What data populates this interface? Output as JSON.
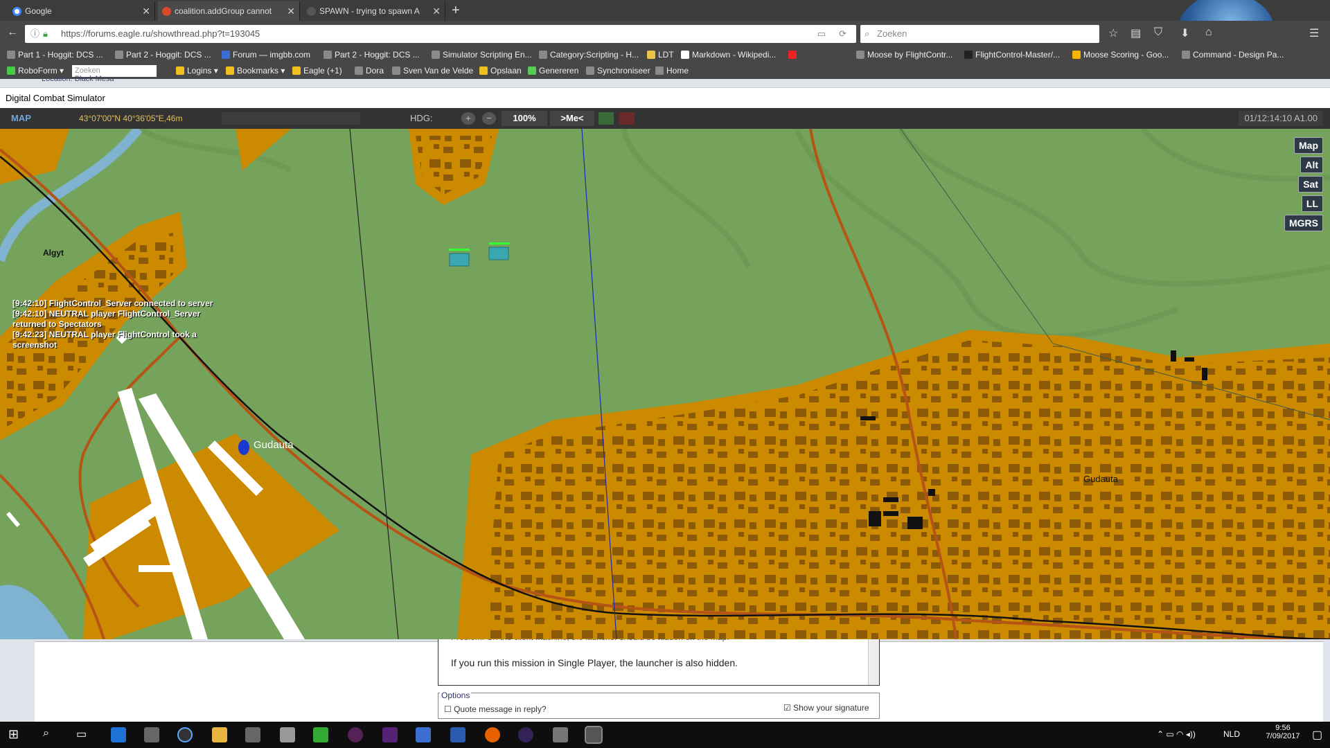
{
  "browser": {
    "tabs": [
      {
        "label": "Google",
        "active": false
      },
      {
        "label": "coalition.addGroup cannot",
        "active": true
      },
      {
        "label": "SPAWN - trying to spawn A",
        "active": false
      }
    ],
    "url": "https://forums.eagle.ru/showthread.php?t=193045",
    "search_placeholder": "Zoeken",
    "bookmarks_row1": [
      "Part 1 - Hoggit: DCS ...",
      "Part 2 - Hoggit: DCS ...",
      "Forum — imgbb.com",
      "Part 2 - Hoggit: DCS ...",
      "Simulator Scripting En...",
      "Category:Scripting - H...",
      "LDT",
      "Markdown - Wikipedi...",
      "Moose by FlightContr...",
      "FlightControl-Master/...",
      "Moose Scoring - Goo...",
      "Command - Design Pa..."
    ],
    "bookmarks_row2": [
      "RoboForm",
      "Logins",
      "Bookmarks",
      "Eagle (+1)",
      "Dora",
      "Sven Van de Velde",
      "Opslaan",
      "Genereren",
      "Synchroniseer",
      "Home"
    ],
    "roboform_search_placeholder": "Zoeken"
  },
  "forum": {
    "location_text": "Location: Black Mesa",
    "editor_line1": "Problem: On the client machine, the launcher should be hidden on the map.",
    "editor_line2": "If you run this mission in Single Player, the launcher is also hidden.",
    "options_label": "Options",
    "quote_label": "Quote message in reply?",
    "signature_label": "Show your signature"
  },
  "dcs": {
    "window_title": "Digital Combat Simulator",
    "map_label": "MAP",
    "coords": "43°07'00\"N 40°36'05\"E,46m",
    "hdg_label": "HDG:",
    "zoom": "100%",
    "me_button": ">Me<",
    "time": "01/12:14:10 A1.00",
    "map_modes": [
      "Map",
      "Alt",
      "Sat",
      "LL",
      "MGRS"
    ],
    "places": {
      "algyt": "Algyt",
      "gudauta_airfield": "Gudauta",
      "gudauta_town": "Gudauta"
    },
    "chat": [
      "[9:42:10] FlightControl_Server connected to server",
      "[9:42:10] NEUTRAL player FlightControl_Server returned to Spectators",
      "[9:42:23] NEUTRAL player FlightControl took a screenshot"
    ]
  },
  "taskbar": {
    "language": "NLD",
    "time": "9:56",
    "date": "7/09/2017"
  },
  "colors": {
    "terrain_green": "#76a35b",
    "urban_orange": "#cc8a00",
    "building_brown": "#8a5a08",
    "road": "#b65416",
    "water": "#7fb3cf"
  }
}
